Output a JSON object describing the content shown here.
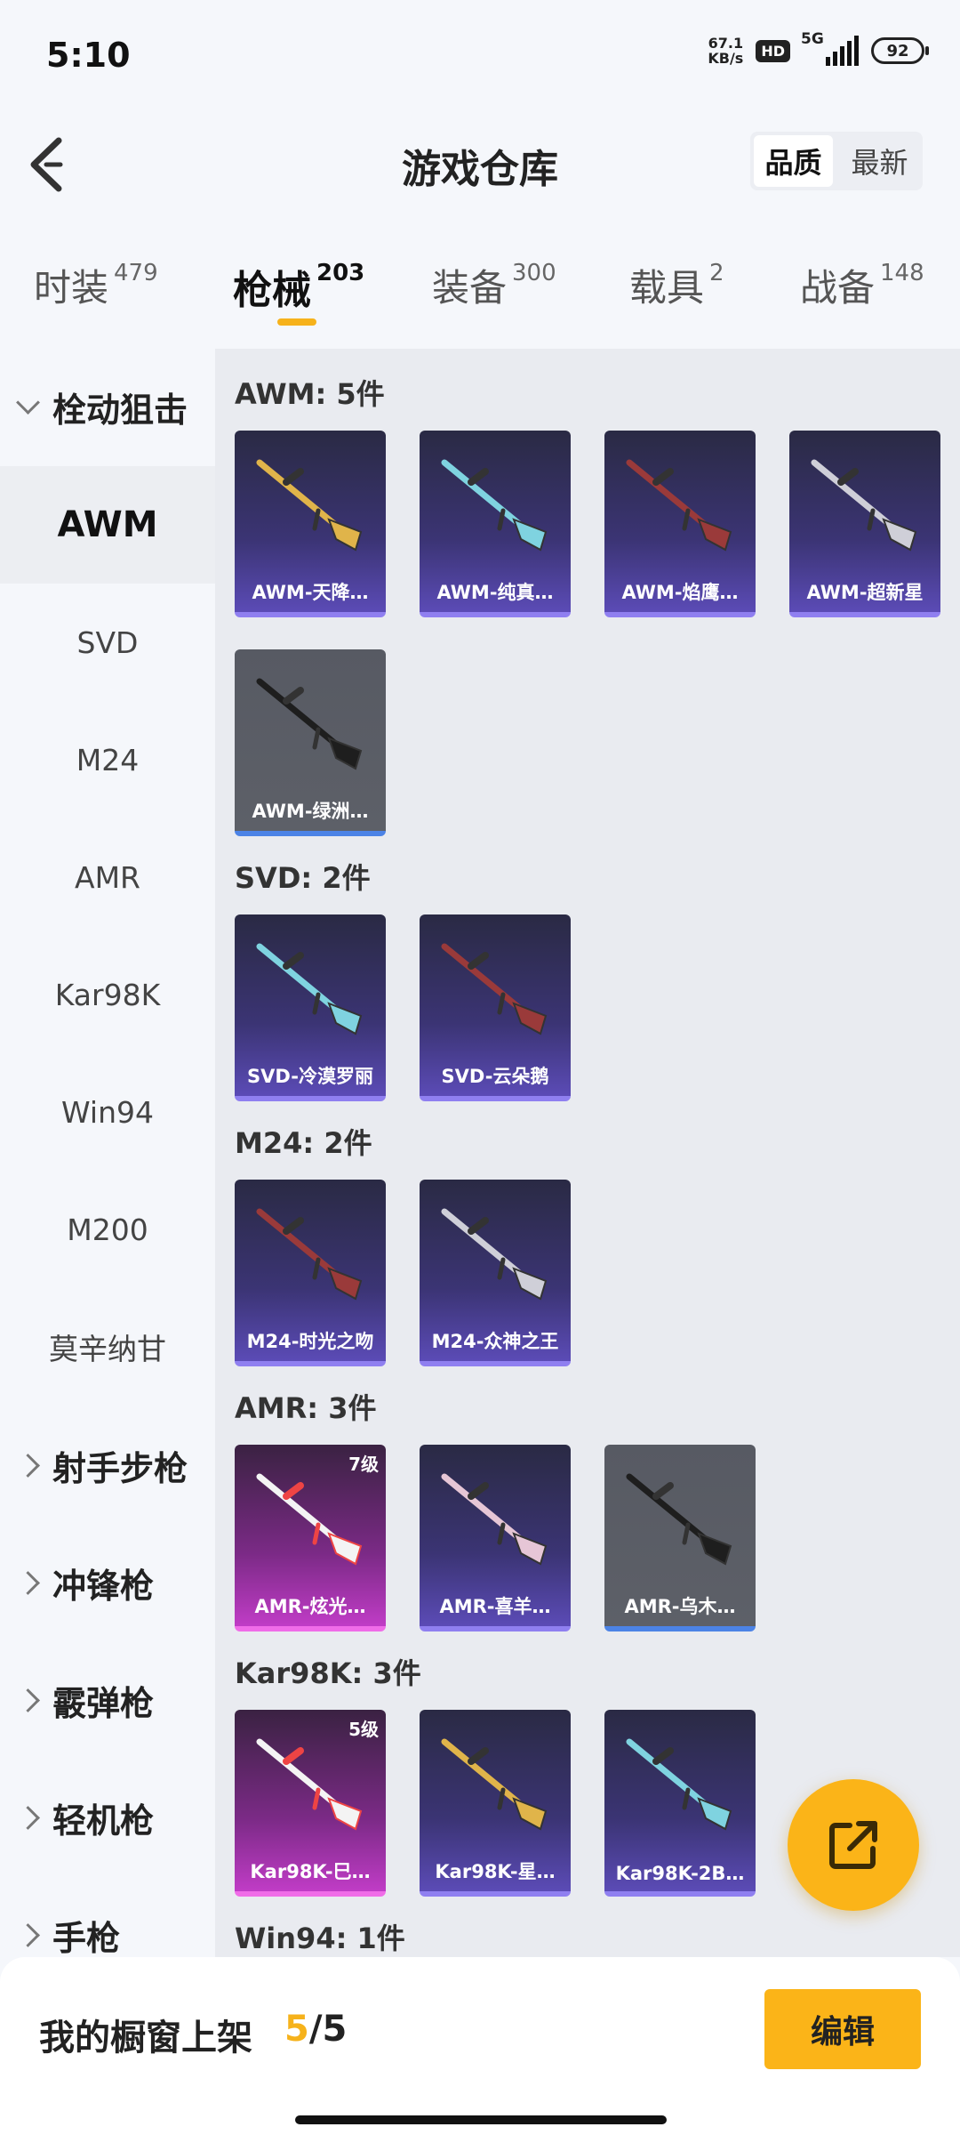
{
  "status_bar": {
    "time": "5:10",
    "net_speed_value": "67.1",
    "net_speed_unit": "KB/s",
    "hd_label": "HD",
    "network_label": "5G",
    "battery": "92"
  },
  "header": {
    "title": "游戏仓库",
    "sort_options": [
      "品质",
      "最新"
    ],
    "sort_active": "品质"
  },
  "category_tabs": [
    {
      "label": "时装",
      "count": "479"
    },
    {
      "label": "枪械",
      "count": "203",
      "active": true
    },
    {
      "label": "装备",
      "count": "300"
    },
    {
      "label": "载具",
      "count": "2"
    },
    {
      "label": "战备",
      "count": "148"
    }
  ],
  "sidebar": {
    "groups": {
      "sniper": "栓动狙击",
      "dmr": "射手步枪",
      "smg": "冲锋枪",
      "shotgun": "霰弹枪",
      "lmg": "轻机枪",
      "pistol": "手枪"
    },
    "items": [
      "AWM",
      "SVD",
      "M24",
      "AMR",
      "Kar98K",
      "Win94",
      "M200",
      "莫辛纳甘"
    ],
    "selected": "AWM"
  },
  "sections": [
    {
      "title": "AWM: 5件",
      "cards": [
        {
          "name": "AWM-天降…",
          "rarity": "purple"
        },
        {
          "name": "AWM-纯真…",
          "rarity": "purple"
        },
        {
          "name": "AWM-焰鹰…",
          "rarity": "purple"
        },
        {
          "name": "AWM-超新星",
          "rarity": "purple"
        },
        {
          "name": "AWM-绿洲…",
          "rarity": "gray"
        }
      ]
    },
    {
      "title": "SVD: 2件",
      "cards": [
        {
          "name": "SVD-冷漠罗丽",
          "rarity": "purple"
        },
        {
          "name": "SVD-云朵鹅",
          "rarity": "purple"
        }
      ]
    },
    {
      "title": "M24: 2件",
      "cards": [
        {
          "name": "M24-时光之吻",
          "rarity": "purple"
        },
        {
          "name": "M24-众神之王",
          "rarity": "purple"
        }
      ]
    },
    {
      "title": "AMR: 3件",
      "cards": [
        {
          "name": "AMR-炫光…",
          "rarity": "pink",
          "level": "7级"
        },
        {
          "name": "AMR-喜羊…",
          "rarity": "purple"
        },
        {
          "name": "AMR-乌木…",
          "rarity": "gray"
        }
      ]
    },
    {
      "title": "Kar98K: 3件",
      "cards": [
        {
          "name": "Kar98K-巳…",
          "rarity": "pink",
          "level": "5级"
        },
        {
          "name": "Kar98K-星…",
          "rarity": "purple"
        },
        {
          "name": "Kar98K-2B…",
          "rarity": "purple"
        }
      ]
    },
    {
      "title": "Win94: 1件",
      "cards": []
    }
  ],
  "fab": {
    "icon": "share-external-icon"
  },
  "bottom_bar": {
    "label": "我的橱窗上架",
    "current": "5",
    "separator": "/",
    "total": "5",
    "edit_label": "编辑"
  },
  "colors": {
    "accent": "#fbb418",
    "rarity_purple": "#8f7ff0",
    "rarity_gray": "#4c83e6",
    "rarity_pink": "#f06ce8"
  }
}
